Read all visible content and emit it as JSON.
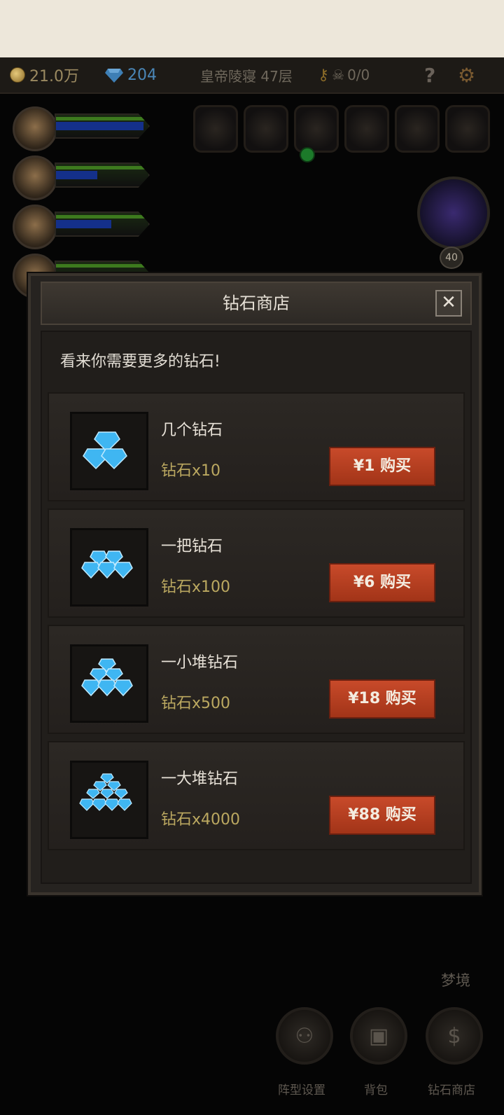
{
  "hud": {
    "gold": "21.0万",
    "diamonds": "204",
    "location": "皇帝陵寝 47层",
    "kills": "0/0",
    "help_icon": "question-mark-icon",
    "settings_icon": "gear-icon"
  },
  "boss": {
    "level": "40"
  },
  "modal": {
    "title": "钻石商店",
    "close_label": "✕",
    "subtitle": "看来你需要更多的钻石!",
    "items": [
      {
        "name": "几个钻石",
        "qty": "钻石x10",
        "buy": "¥1 购买"
      },
      {
        "name": "一把钻石",
        "qty": "钻石x100",
        "buy": "¥6 购买"
      },
      {
        "name": "一小堆钻石",
        "qty": "钻石x500",
        "buy": "¥18 购买"
      },
      {
        "name": "一大堆钻石",
        "qty": "钻石x4000",
        "buy": "¥88 购买"
      }
    ]
  },
  "footer": {
    "dream": "梦境",
    "nav": [
      {
        "label": "阵型设置",
        "icon": "formation-icon"
      },
      {
        "label": "背包",
        "icon": "backpack-icon"
      },
      {
        "label": "钻石商店",
        "icon": "dollar-icon"
      }
    ]
  },
  "colors": {
    "buy_button": "#b23a1e",
    "qty_text": "#bba860",
    "diamond": "#3fb6f2"
  }
}
